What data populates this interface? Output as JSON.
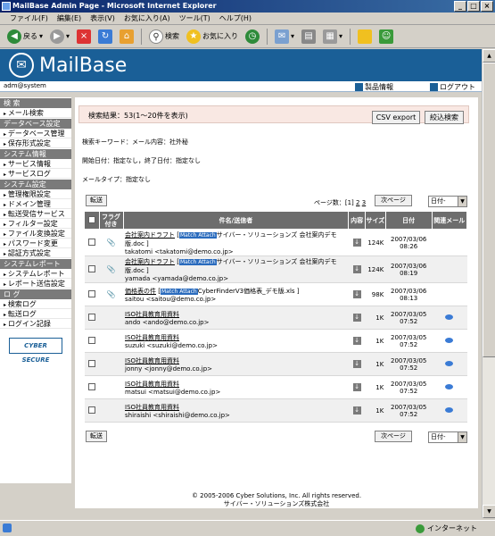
{
  "window": {
    "title": "MailBase Admin Page - Microsoft Internet Explorer"
  },
  "menu": [
    "ファイル(F)",
    "編集(E)",
    "表示(V)",
    "お気に入り(A)",
    "ツール(T)",
    "ヘルプ(H)"
  ],
  "toolbar": {
    "back": "戻る",
    "search": "検索",
    "favorites": "お気に入り"
  },
  "header": {
    "logo": "MailBase",
    "user": "adm@system",
    "product_info": "製品情報",
    "logout": "ログアウト"
  },
  "sidebar": {
    "sections": [
      {
        "title": "検 索",
        "items": [
          "メール検索"
        ]
      },
      {
        "title": "データベース設定",
        "items": [
          "データベース管理",
          "保存形式設定"
        ]
      },
      {
        "title": "システム情報",
        "items": [
          "サービス情報",
          "サービスログ"
        ]
      },
      {
        "title": "システム設定",
        "items": [
          "管理権限設定",
          "ドメイン管理",
          "転送受信サービス",
          "フィルター設定",
          "ファイル変換設定",
          "パスワード変更",
          "認証方式設定"
        ]
      },
      {
        "title": "システムレポート",
        "items": [
          "システムレポート",
          "レポート送信設定"
        ]
      },
      {
        "title": "ロ グ",
        "items": [
          "検索ログ",
          "転送ログ",
          "ログイン記録"
        ]
      }
    ],
    "badge": "CYBER SECURE"
  },
  "main": {
    "result_title": "検索結果：53(1～20件を表示)",
    "csv_button": "CSV export",
    "refine_button": "絞込検索",
    "keyword": "検索キーワード：メール内容：社外秘",
    "dates": "開始日付：指定なし，終了日付：指定なし",
    "mailtype": "メールタイプ：指定なし",
    "forward_button": "転送",
    "pages_label": "ページ数：",
    "page_current": "[1]",
    "page_2": "2",
    "page_3": "3",
    "next_button": "次ページ",
    "sort_select": "日付-",
    "columns": {
      "flag": "フラグ付き",
      "subject": "件名/送信者",
      "content": "内容",
      "size": "サイズ",
      "date": "日付",
      "related": "関連メール"
    },
    "rows": [
      {
        "subject": "会社案内ドラフト",
        "tag": "Match Attach",
        "attach": "サイバー・ソリューションズ 会社案内デモ版.doc ]",
        "sender": "takatomi <takatomi@demo.co.jp>",
        "size": "124K",
        "date": "2007/03/06",
        "time": "08:26",
        "clip": true,
        "related": false
      },
      {
        "subject": "会社案内ドラフト",
        "tag": "Match Attach",
        "attach": "サイバー・ソリューションズ 会社案内デモ版.doc ]",
        "sender": "yamada <yamada@demo.co.jp>",
        "size": "124K",
        "date": "2007/03/06",
        "time": "08:19",
        "clip": true,
        "related": false
      },
      {
        "subject": "価格表の件",
        "tag": "Match Attach",
        "attach": "CyberFinderV3価格表_デモ版.xls ]",
        "sender": "saitou <saitou@demo.co.jp>",
        "size": "98K",
        "date": "2007/03/06",
        "time": "08:13",
        "clip": true,
        "related": false
      },
      {
        "subject": "ISO社員教育用資料",
        "tag": "",
        "attach": "",
        "sender": "ando <ando@demo.co.jp>",
        "size": "1K",
        "date": "2007/03/05",
        "time": "07:52",
        "clip": false,
        "related": true
      },
      {
        "subject": "ISO社員教育用資料",
        "tag": "",
        "attach": "",
        "sender": "suzuki <suzuki@demo.co.jp>",
        "size": "1K",
        "date": "2007/03/05",
        "time": "07:52",
        "clip": false,
        "related": true
      },
      {
        "subject": "ISO社員教育用資料",
        "tag": "",
        "attach": "",
        "sender": "jonny <jonny@demo.co.jp>",
        "size": "1K",
        "date": "2007/03/05",
        "time": "07:52",
        "clip": false,
        "related": true
      },
      {
        "subject": "ISO社員教育用資料",
        "tag": "",
        "attach": "",
        "sender": "matsui <matsui@demo.co.jp>",
        "size": "1K",
        "date": "2007/03/05",
        "time": "07:52",
        "clip": false,
        "related": true
      },
      {
        "subject": "ISO社員教育用資料",
        "tag": "",
        "attach": "",
        "sender": "shiraishi <shiraishi@demo.co.jp>",
        "size": "1K",
        "date": "2007/03/05",
        "time": "07:52",
        "clip": false,
        "related": true
      }
    ]
  },
  "footer": {
    "line1": "© 2005-2006 Cyber Solutions, Inc. All rights reserved.",
    "line2": "サイバー・ソリューションズ株式会社"
  },
  "status": {
    "zone": "インターネット"
  }
}
